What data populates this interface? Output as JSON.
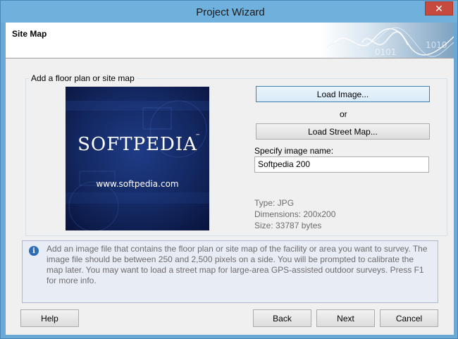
{
  "window": {
    "title": "Project Wizard",
    "close_glyph": "✕"
  },
  "header": {
    "title": "Site Map",
    "art_text_1": "0101",
    "art_text_2": "1010"
  },
  "group": {
    "legend": "Add a floor plan or site map"
  },
  "preview": {
    "brand": "SOFTPEDIA",
    "trademark": "™",
    "url": "www.softpedia.com"
  },
  "actions": {
    "load_image": "Load Image...",
    "or": "or",
    "load_street_map": "Load Street Map..."
  },
  "image_name": {
    "label": "Specify image name:",
    "value": "Softpedia 200"
  },
  "image_info": {
    "type": "Type: JPG",
    "dimensions": "Dimensions: 200x200",
    "size": "Size: 33787 bytes"
  },
  "info": {
    "icon": "info-icon",
    "text": "Add an image file that contains the floor plan or site map of the facility or area you want to survey. The image file should be between 250 and 2,500 pixels on a side. You will be prompted to calibrate the map later. You may want to load a street map for large-area GPS-assisted outdoor surveys. Press F1 for more info."
  },
  "footer": {
    "help": "Help",
    "back": "Back",
    "next": "Next",
    "cancel": "Cancel"
  }
}
